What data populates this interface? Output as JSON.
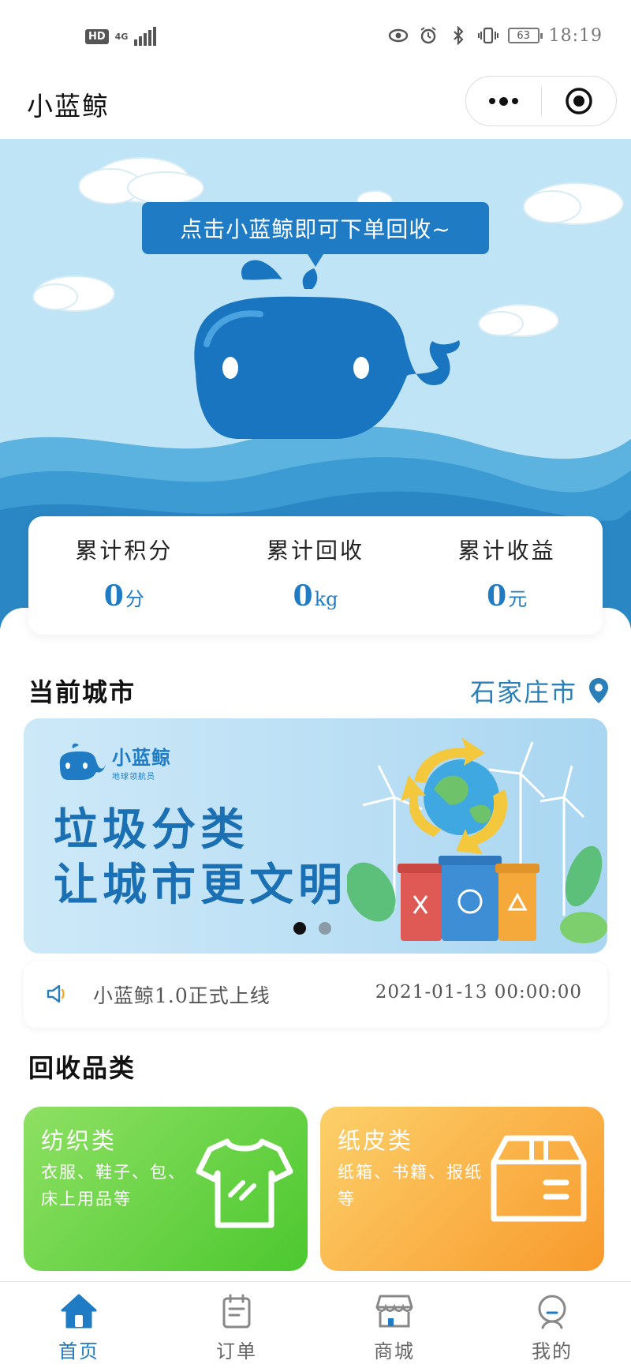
{
  "status_bar": {
    "hd": "HD",
    "network": "4G",
    "battery": "63",
    "time": "18:19"
  },
  "title_bar": {
    "title": "小蓝鲸"
  },
  "hero": {
    "bubble_text": "点击小蓝鲸即可下单回收~"
  },
  "stats": [
    {
      "label": "累计积分",
      "value": "0",
      "unit": "分"
    },
    {
      "label": "累计回收",
      "value": "0",
      "unit": "kg"
    },
    {
      "label": "累计收益",
      "value": "0",
      "unit": "元"
    }
  ],
  "city": {
    "heading": "当前城市",
    "name": "石家庄市"
  },
  "banner": {
    "brand": "小蓝鲸",
    "brand_sub": "地球领航员",
    "line1": "垃圾分类",
    "line2": "让城市更文明",
    "active_slide": 1,
    "slide_count": 2
  },
  "notice": {
    "text": "小蓝鲸1.0正式上线",
    "date": "2021-01-13 00:00:00"
  },
  "categories_heading": "回收品类",
  "categories": [
    {
      "title": "纺织类",
      "desc": "衣服、鞋子、包、床上用品等",
      "icon": "tshirt-icon",
      "color_start": "#8ee063",
      "color_end": "#4cc82f"
    },
    {
      "title": "纸皮类",
      "desc": "纸箱、书籍、报纸等",
      "icon": "box-icon",
      "color_start": "#fcd06a",
      "color_end": "#f89a2c"
    }
  ],
  "tabbar": [
    {
      "label": "首页",
      "icon": "home-icon",
      "active": true
    },
    {
      "label": "订单",
      "icon": "order-icon",
      "active": false
    },
    {
      "label": "商城",
      "icon": "shop-icon",
      "active": false
    },
    {
      "label": "我的",
      "icon": "user-icon",
      "active": false
    }
  ],
  "colors": {
    "brand_blue": "#1f7bc4",
    "sky": "#bfe4f6",
    "active_tab": "#1f7bc4"
  }
}
